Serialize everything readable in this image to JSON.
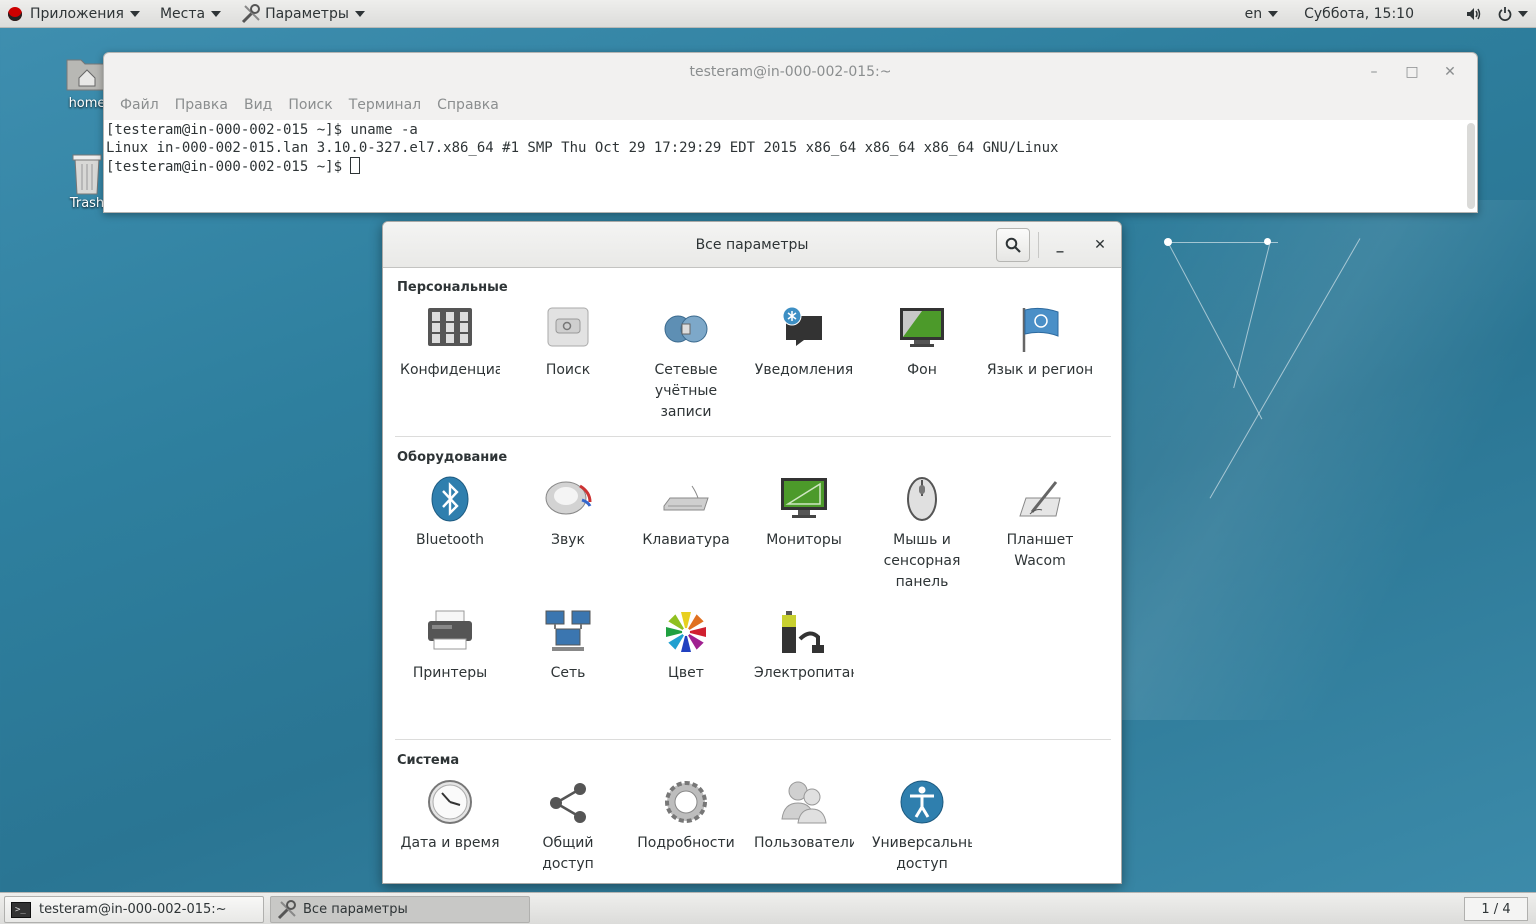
{
  "topbar": {
    "applications": "Приложения",
    "places": "Места",
    "settings_app": "Параметры",
    "lang": "en",
    "datetime": "Суббота, 15:10"
  },
  "desktop": {
    "icons": [
      {
        "label": "home",
        "icon": "home-folder-icon"
      },
      {
        "label": "Trash",
        "icon": "trash-icon"
      }
    ]
  },
  "terminal": {
    "title": "testeram@in-000-002-015:~",
    "menu": [
      "Файл",
      "Правка",
      "Вид",
      "Поиск",
      "Терминал",
      "Справка"
    ],
    "lines": [
      "[testeram@in-000-002-015 ~]$ uname -a",
      "Linux in-000-002-015.lan 3.10.0-327.el7.x86_64 #1 SMP Thu Oct 29 17:29:29 EDT 2015 x86_64 x86_64 x86_64 GNU/Linux",
      "[testeram@in-000-002-015 ~]$ "
    ]
  },
  "settings": {
    "title": "Все параметры",
    "sections": [
      {
        "title": "Персональные"
      },
      {
        "title": "Оборудование"
      },
      {
        "title": "Система"
      }
    ],
    "personal": [
      {
        "label": "Конфиденциальность",
        "icon": "privacy-icon"
      },
      {
        "label": "Поиск",
        "icon": "search-settings-icon"
      },
      {
        "label": "Сетевые учётные записи",
        "icon": "online-accounts-icon"
      },
      {
        "label": "Уведомления",
        "icon": "notifications-icon"
      },
      {
        "label": "Фон",
        "icon": "background-icon"
      },
      {
        "label": "Язык и регион",
        "icon": "region-flag-icon"
      }
    ],
    "hardware": [
      {
        "label": "Bluetooth",
        "icon": "bluetooth-icon"
      },
      {
        "label": "Звук",
        "icon": "sound-icon"
      },
      {
        "label": "Клавиатура",
        "icon": "keyboard-icon"
      },
      {
        "label": "Мониторы",
        "icon": "monitor-icon"
      },
      {
        "label": "Мышь и сенсорная панель",
        "icon": "mouse-icon"
      },
      {
        "label": "Планшет Wacom",
        "icon": "tablet-icon"
      },
      {
        "label": "Принтеры",
        "icon": "printer-icon"
      },
      {
        "label": "Сеть",
        "icon": "network-icon"
      },
      {
        "label": "Цвет",
        "icon": "color-icon"
      },
      {
        "label": "Электропитание",
        "icon": "power-icon"
      }
    ],
    "system": [
      {
        "label": "Дата и время",
        "icon": "clock-icon"
      },
      {
        "label": "Общий доступ",
        "icon": "sharing-icon"
      },
      {
        "label": "Подробности",
        "icon": "details-gear-icon"
      },
      {
        "label": "Пользователи",
        "icon": "users-icon"
      },
      {
        "label": "Универсальный доступ",
        "icon": "accessibility-icon"
      }
    ]
  },
  "taskbar": {
    "tasks": [
      {
        "label": "testeram@in-000-002-015:~",
        "icon": "terminal-icon"
      },
      {
        "label": "Все параметры",
        "icon": "settings-tools-icon"
      }
    ],
    "workspace": "1 / 4"
  },
  "colors": {
    "desktop_bg": "#2e7f9e",
    "bluetooth": "#2f7fae",
    "accessibility": "#2f7fae"
  }
}
